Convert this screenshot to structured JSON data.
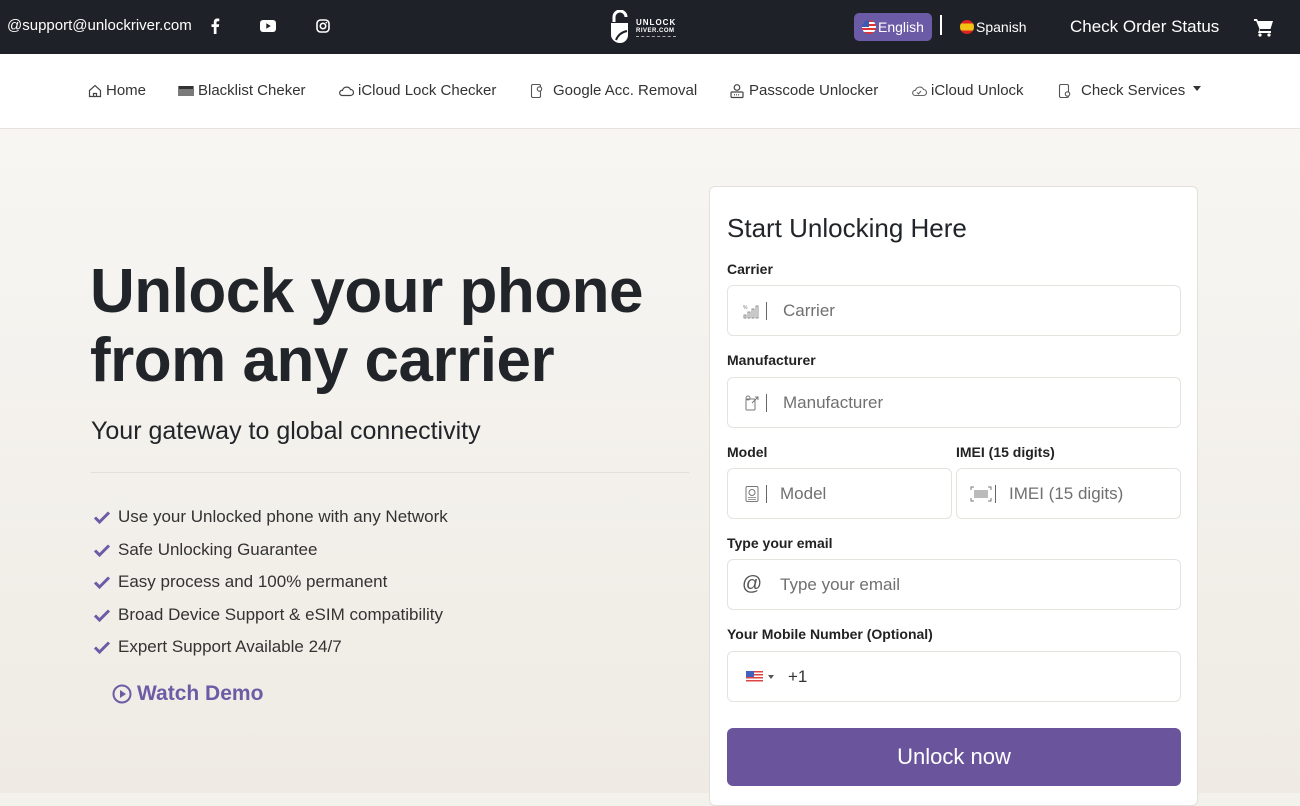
{
  "topbar": {
    "email": "@support@unlockriver.com",
    "social": [
      "facebook-icon",
      "youtube-icon",
      "instagram-icon"
    ],
    "logo": {
      "line1": "UNLOCK",
      "line2": "RIVER.COM"
    },
    "languages": [
      {
        "label": "English",
        "active": true
      },
      {
        "label": "Spanish",
        "active": false
      }
    ],
    "order_status": "Check Order Status",
    "cart_icon": "cart-icon"
  },
  "nav": {
    "items": [
      {
        "label": "Home",
        "icon": "home-icon"
      },
      {
        "label": "Blacklist Cheker",
        "icon": "barcode-icon"
      },
      {
        "label": "iCloud Lock Checker",
        "icon": "cloud-icon"
      },
      {
        "label": "Google Acc. Removal",
        "icon": "phone-lock-icon"
      },
      {
        "label": "Passcode Unlocker",
        "icon": "user-lock-icon"
      },
      {
        "label": "iCloud Unlock",
        "icon": "cloud-check-icon"
      },
      {
        "label": "Check Services",
        "icon": "phone-search-icon",
        "dropdown": true
      }
    ]
  },
  "hero": {
    "headline_line1": "Unlock your phone",
    "headline_line2": "from any carrier",
    "subheadline": "Your gateway to global connectivity",
    "features": [
      "Use your Unlocked phone with any Network",
      "Safe Unlocking Guarantee",
      "Easy process and 100% permanent",
      "Broad Device Support & eSIM compatibility",
      "Expert Support Available 24/7"
    ],
    "watch_demo": "Watch Demo"
  },
  "form": {
    "title": "Start Unlocking Here",
    "carrier": {
      "label": "Carrier",
      "placeholder": "Carrier",
      "value": ""
    },
    "manufacturer": {
      "label": "Manufacturer",
      "placeholder": "Manufacturer",
      "value": ""
    },
    "model": {
      "label": "Model",
      "placeholder": "Model",
      "value": ""
    },
    "imei": {
      "label": "IMEI (15 digits)",
      "placeholder": "IMEI (15 digits)",
      "value": ""
    },
    "email": {
      "label": "Type your email",
      "placeholder": "Type your email",
      "value": ""
    },
    "phone": {
      "label": "Your Mobile Number (Optional)",
      "country": "US",
      "code": "+1",
      "value": ""
    },
    "submit_label": "Unlock now"
  },
  "colors": {
    "topbar_bg": "#1f2128",
    "accent_purple": "#6a559c",
    "active_lang_bg": "#6b5ba7",
    "check_color": "#6d5ba6"
  }
}
